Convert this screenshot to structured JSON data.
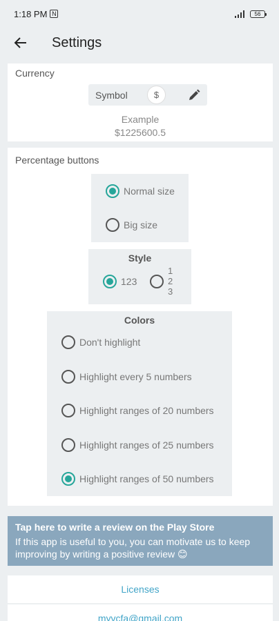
{
  "status_bar": {
    "time": "1:18 PM",
    "nfc_letter": "N",
    "signal": "..ıl",
    "battery": "56"
  },
  "app_bar": {
    "title": "Settings"
  },
  "currency": {
    "title": "Currency",
    "symbol_label": "Symbol",
    "symbol_value": "$",
    "example_label": "Example",
    "example_value": "$1225600.5"
  },
  "percentage": {
    "title": "Percentage buttons",
    "size_options": [
      {
        "label": "Normal size",
        "selected": true
      },
      {
        "label": "Big size",
        "selected": false
      }
    ],
    "style": {
      "title": "Style",
      "options": [
        {
          "label": "123",
          "selected": true
        },
        {
          "lines": [
            "1",
            "2",
            "3"
          ],
          "selected": false
        }
      ]
    },
    "colors": {
      "title": "Colors",
      "options": [
        {
          "label": "Don't highlight",
          "selected": false
        },
        {
          "label": "Highlight every 5 numbers",
          "selected": false
        },
        {
          "label": "Highlight ranges of 20 numbers",
          "selected": false
        },
        {
          "label": "Highlight ranges of 25 numbers",
          "selected": false
        },
        {
          "label": "Highlight ranges of 50 numbers",
          "selected": true
        }
      ]
    }
  },
  "review": {
    "title": "Tap here to write a review on the Play Store",
    "text": "If this app is useful to you, you can motivate us to keep improving by writing a positive review 😊"
  },
  "links": {
    "licenses": "Licenses",
    "email": "myvcfa@gmail.com"
  },
  "colors": {
    "accent": "#26a69a",
    "review_bg": "#8aa7bd",
    "link": "#42a5c8",
    "background": "#eceff1"
  }
}
